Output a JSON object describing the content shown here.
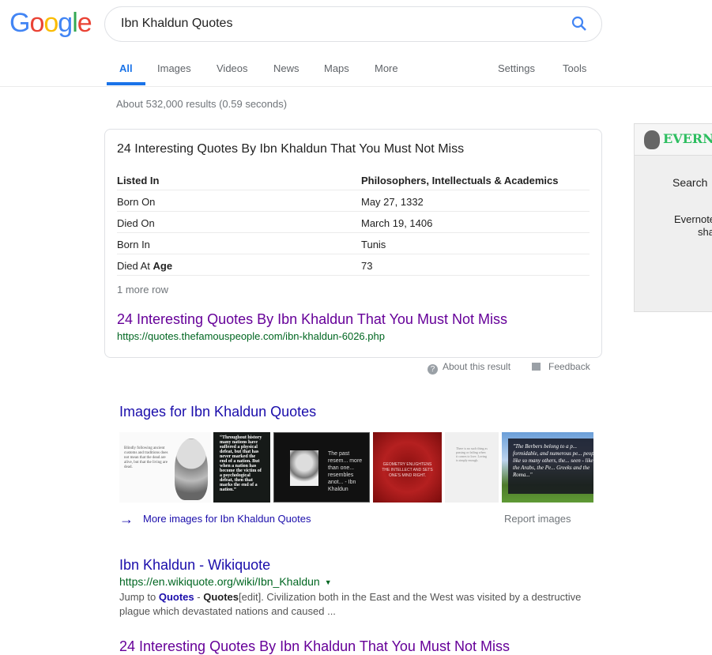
{
  "logo": "Google",
  "search": {
    "query": "Ibn Khaldun Quotes"
  },
  "tabs": [
    "All",
    "Images",
    "Videos",
    "News",
    "Maps",
    "More",
    "Settings",
    "Tools"
  ],
  "stats": "About 532,000 results (0.59 seconds)",
  "card": {
    "title": "24 Interesting Quotes By Ibn Khaldun That You Must Not Miss",
    "rows": [
      {
        "label": "Listed In",
        "value": "Philosophers, Intellectuals & Academics"
      },
      {
        "label": "Born On",
        "value": "May 27, 1332"
      },
      {
        "label": "Died On",
        "value": "March 19, 1406"
      },
      {
        "label": "Born In",
        "value": "Tunis"
      },
      {
        "label": "Died At ",
        "label_bold": "Age",
        "value": "73"
      }
    ],
    "more_row": "1 more row",
    "link": "24 Interesting Quotes By Ibn Khaldun That You Must Not Miss",
    "url": "https://quotes.thefamouspeople.com/ibn-khaldun-6026.php"
  },
  "about_result": "About this result",
  "feedback": "Feedback",
  "images": {
    "heading": "Images for Ibn Khaldun Quotes",
    "thumbs": [
      "Blindly following ancient customs and traditions does not mean that the dead are alive, but that the living are dead.",
      "“Throughout history many nations have suffered a physical defeat, but that has never marked the end of a nation. But when a nation has become the victim of a psychological defeat, then that marks the end of a nation.”",
      "The past resem... more than one... resembles anot... - Ibn Khaldun",
      "GEOMETRY ENLIGHTENS THE INTELLECT AND SETS ONE'S MIND RIGHT.",
      "There is no such thing as passing or failing when it comes to love. Loving is simply enough.",
      "\"The Berbers belong to a p... formidable, and numerous pe... people like so many others, the... seen - like the Arabs, the Pe... Greeks and the Roma...\""
    ],
    "more": "More images for Ibn Khaldun Quotes",
    "report": "Report images"
  },
  "results": [
    {
      "title": "Ibn Khaldun - Wikiquote",
      "url": "https://en.wikiquote.org/wiki/Ibn_Khaldun",
      "snippet_pre": "Jump to ",
      "snippet_b1": "Quotes",
      "snippet_mid": " - ",
      "snippet_b2": "Quotes",
      "snippet_post": "[edit]. Civilization both in the East and the West was visited by a destructive plague which devastated nations and caused ..."
    },
    {
      "title": "24 Interesting Quotes By Ibn Khaldun That You Must Not Miss"
    }
  ],
  "evernote": {
    "name": "EVERNOTE",
    "search": "Search",
    "line1": "Evernote",
    "line2": "share"
  },
  "colors": {
    "link": "#1a0dab",
    "visited": "#660099",
    "url": "#006621",
    "accent": "#1a73e8"
  }
}
